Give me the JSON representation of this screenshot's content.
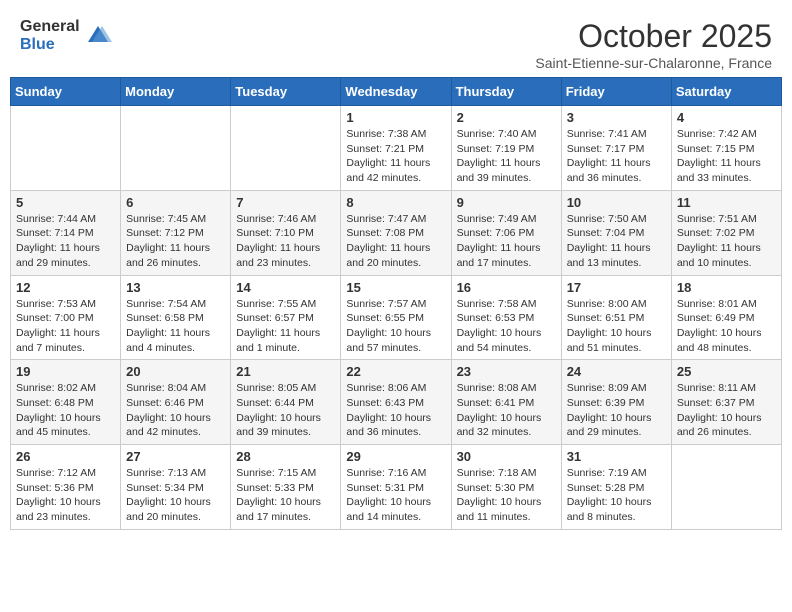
{
  "header": {
    "logo_general": "General",
    "logo_blue": "Blue",
    "month_title": "October 2025",
    "location": "Saint-Etienne-sur-Chalaronne, France"
  },
  "days_of_week": [
    "Sunday",
    "Monday",
    "Tuesday",
    "Wednesday",
    "Thursday",
    "Friday",
    "Saturday"
  ],
  "weeks": [
    [
      {
        "day": "",
        "info": ""
      },
      {
        "day": "",
        "info": ""
      },
      {
        "day": "",
        "info": ""
      },
      {
        "day": "1",
        "info": "Sunrise: 7:38 AM\nSunset: 7:21 PM\nDaylight: 11 hours and 42 minutes."
      },
      {
        "day": "2",
        "info": "Sunrise: 7:40 AM\nSunset: 7:19 PM\nDaylight: 11 hours and 39 minutes."
      },
      {
        "day": "3",
        "info": "Sunrise: 7:41 AM\nSunset: 7:17 PM\nDaylight: 11 hours and 36 minutes."
      },
      {
        "day": "4",
        "info": "Sunrise: 7:42 AM\nSunset: 7:15 PM\nDaylight: 11 hours and 33 minutes."
      }
    ],
    [
      {
        "day": "5",
        "info": "Sunrise: 7:44 AM\nSunset: 7:14 PM\nDaylight: 11 hours and 29 minutes."
      },
      {
        "day": "6",
        "info": "Sunrise: 7:45 AM\nSunset: 7:12 PM\nDaylight: 11 hours and 26 minutes."
      },
      {
        "day": "7",
        "info": "Sunrise: 7:46 AM\nSunset: 7:10 PM\nDaylight: 11 hours and 23 minutes."
      },
      {
        "day": "8",
        "info": "Sunrise: 7:47 AM\nSunset: 7:08 PM\nDaylight: 11 hours and 20 minutes."
      },
      {
        "day": "9",
        "info": "Sunrise: 7:49 AM\nSunset: 7:06 PM\nDaylight: 11 hours and 17 minutes."
      },
      {
        "day": "10",
        "info": "Sunrise: 7:50 AM\nSunset: 7:04 PM\nDaylight: 11 hours and 13 minutes."
      },
      {
        "day": "11",
        "info": "Sunrise: 7:51 AM\nSunset: 7:02 PM\nDaylight: 11 hours and 10 minutes."
      }
    ],
    [
      {
        "day": "12",
        "info": "Sunrise: 7:53 AM\nSunset: 7:00 PM\nDaylight: 11 hours and 7 minutes."
      },
      {
        "day": "13",
        "info": "Sunrise: 7:54 AM\nSunset: 6:58 PM\nDaylight: 11 hours and 4 minutes."
      },
      {
        "day": "14",
        "info": "Sunrise: 7:55 AM\nSunset: 6:57 PM\nDaylight: 11 hours and 1 minute."
      },
      {
        "day": "15",
        "info": "Sunrise: 7:57 AM\nSunset: 6:55 PM\nDaylight: 10 hours and 57 minutes."
      },
      {
        "day": "16",
        "info": "Sunrise: 7:58 AM\nSunset: 6:53 PM\nDaylight: 10 hours and 54 minutes."
      },
      {
        "day": "17",
        "info": "Sunrise: 8:00 AM\nSunset: 6:51 PM\nDaylight: 10 hours and 51 minutes."
      },
      {
        "day": "18",
        "info": "Sunrise: 8:01 AM\nSunset: 6:49 PM\nDaylight: 10 hours and 48 minutes."
      }
    ],
    [
      {
        "day": "19",
        "info": "Sunrise: 8:02 AM\nSunset: 6:48 PM\nDaylight: 10 hours and 45 minutes."
      },
      {
        "day": "20",
        "info": "Sunrise: 8:04 AM\nSunset: 6:46 PM\nDaylight: 10 hours and 42 minutes."
      },
      {
        "day": "21",
        "info": "Sunrise: 8:05 AM\nSunset: 6:44 PM\nDaylight: 10 hours and 39 minutes."
      },
      {
        "day": "22",
        "info": "Sunrise: 8:06 AM\nSunset: 6:43 PM\nDaylight: 10 hours and 36 minutes."
      },
      {
        "day": "23",
        "info": "Sunrise: 8:08 AM\nSunset: 6:41 PM\nDaylight: 10 hours and 32 minutes."
      },
      {
        "day": "24",
        "info": "Sunrise: 8:09 AM\nSunset: 6:39 PM\nDaylight: 10 hours and 29 minutes."
      },
      {
        "day": "25",
        "info": "Sunrise: 8:11 AM\nSunset: 6:37 PM\nDaylight: 10 hours and 26 minutes."
      }
    ],
    [
      {
        "day": "26",
        "info": "Sunrise: 7:12 AM\nSunset: 5:36 PM\nDaylight: 10 hours and 23 minutes."
      },
      {
        "day": "27",
        "info": "Sunrise: 7:13 AM\nSunset: 5:34 PM\nDaylight: 10 hours and 20 minutes."
      },
      {
        "day": "28",
        "info": "Sunrise: 7:15 AM\nSunset: 5:33 PM\nDaylight: 10 hours and 17 minutes."
      },
      {
        "day": "29",
        "info": "Sunrise: 7:16 AM\nSunset: 5:31 PM\nDaylight: 10 hours and 14 minutes."
      },
      {
        "day": "30",
        "info": "Sunrise: 7:18 AM\nSunset: 5:30 PM\nDaylight: 10 hours and 11 minutes."
      },
      {
        "day": "31",
        "info": "Sunrise: 7:19 AM\nSunset: 5:28 PM\nDaylight: 10 hours and 8 minutes."
      },
      {
        "day": "",
        "info": ""
      }
    ]
  ]
}
